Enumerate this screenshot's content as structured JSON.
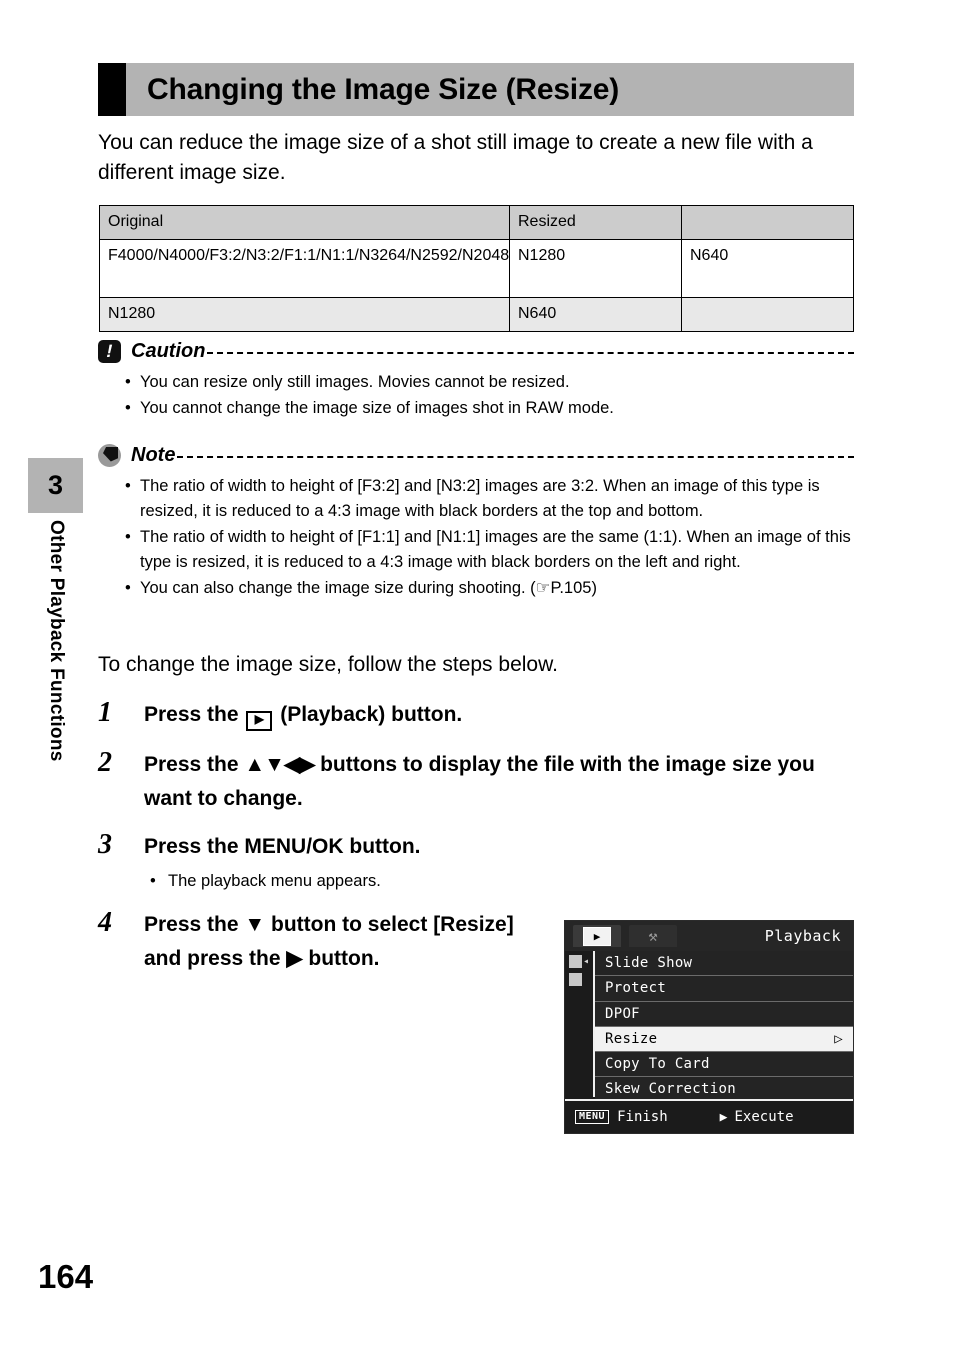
{
  "sidebar": {
    "chapter_number": "3",
    "chapter_title": "Other Playback Functions",
    "page_number": "164"
  },
  "header": {
    "title": "Changing the Image Size (Resize)"
  },
  "intro": "You can reduce the image size of a shot still image to create a new file with a different image size.",
  "spec_table": {
    "headers": [
      "Original",
      "Resized"
    ],
    "rows": [
      {
        "original": "F4000/N4000/F3:2/N3:2/F1:1/N1:1/N3264/N2592/N2048",
        "resized_1": "N1280",
        "resized_2": "N640"
      },
      {
        "original": "N1280",
        "resized_1": "N640",
        "resized_2": ""
      }
    ]
  },
  "caution": {
    "label": "Caution",
    "items": [
      "You can resize only still images. Movies cannot be resized.",
      "You cannot change the image size of images shot in RAW mode."
    ]
  },
  "note": {
    "label": "Note",
    "items": [
      "The ratio of width to height of [F3:2] and [N3:2] images are 3:2. When an image of this type is resized, it is reduced to a 4:3 image with black borders at the top and bottom.",
      "The ratio of width to height of [F1:1] and [N1:1] images are the same (1:1). When an image of this type is resized, it is reduced to a 4:3 image with black borders on the left and right.",
      "You can also change the image size during shooting. (☞P.105)"
    ]
  },
  "lead_in": "To change the image size, follow the steps below.",
  "steps": [
    {
      "number": "1",
      "text_before": "Press the ",
      "icon": "playback-button-icon",
      "icon_glyph": "▶",
      "text_after": " (Playback) button.",
      "sub": []
    },
    {
      "number": "2",
      "text_before": "Press the ",
      "icon": "direction-pad-arrows-icon",
      "icon_glyph": "▲▼◀▶",
      "text_after": " buttons to display the file with the image size you want to change.",
      "sub": []
    },
    {
      "number": "3",
      "text_before": "Press the MENU/OK button.",
      "icon": "",
      "icon_glyph": "",
      "text_after": "",
      "sub": [
        "The playback menu appears."
      ]
    },
    {
      "number": "4",
      "text_before": "Press the ",
      "icon": "down-arrow-icon",
      "icon_glyph": "▼",
      "text_after": " button to select [Resize] and press the ▶ button.",
      "sub": []
    }
  ],
  "lcd": {
    "screen_title": "Playback",
    "tabs": [
      {
        "name": "playback-tab",
        "glyph": "▶",
        "active": true
      },
      {
        "name": "setup-tab",
        "glyph": "⚒",
        "active": false
      }
    ],
    "menu_items": [
      {
        "label": "Slide Show",
        "selected": false,
        "chevron": ""
      },
      {
        "label": "Protect",
        "selected": false,
        "chevron": ""
      },
      {
        "label": "DPOF",
        "selected": false,
        "chevron": ""
      },
      {
        "label": "Resize",
        "selected": true,
        "chevron": "▷"
      },
      {
        "label": "Copy To Card",
        "selected": false,
        "chevron": ""
      },
      {
        "label": "Skew Correction",
        "selected": false,
        "chevron": ""
      }
    ],
    "footer": {
      "menu_key": "MENU",
      "finish_label": "Finish",
      "execute_arrow": "▶",
      "execute_label": "Execute"
    }
  }
}
